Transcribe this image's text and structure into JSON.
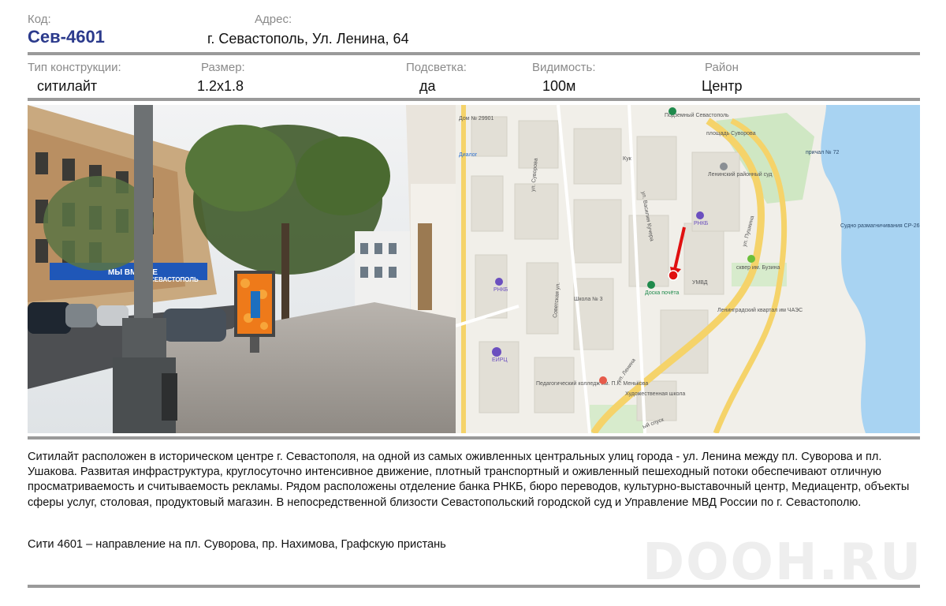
{
  "header": {
    "code_label": "Код:",
    "code_value": "Сев-4601",
    "address_label": "Адрес:",
    "address_value": "г. Севастополь, Ул. Ленина, 64"
  },
  "specs": {
    "type_label": "Тип конструкции:",
    "type_value": "ситилайт",
    "size_label": "Размер:",
    "size_value": "1.2x1.8",
    "light_label": "Подсветка:",
    "light_value": "да",
    "visibility_label": "Видимость:",
    "visibility_value": "100м",
    "district_label": "Район",
    "district_value": "Центр"
  },
  "photo": {
    "sign_text": "МЫ ВМЕСТЕ",
    "sign_text2": "СЕВАСТОПОЛЬ"
  },
  "map": {
    "labels": {
      "metro": "Подземный Севастополь",
      "square": "площадь Суворова",
      "pier": "причал № 72",
      "court": "Ленинский районный суд",
      "rnkb1": "РНКБ",
      "pushkina": "ул. Пушкина",
      "ship": "Судно размагничивания СР-26",
      "square2": "сквер им. Бузина",
      "umvd": "УМВД",
      "board": "Доска почёта",
      "leningrad": "Ленинградский квартал им ЧАЭС",
      "suvorova": "ул. Суворова",
      "kucera": "ул. Василия Кучера",
      "sovetskaya": "Советская ул.",
      "school3": "Школа № 3",
      "rnkb2": "РНКБ",
      "eirc": "ЕИРЦ",
      "lenina": "ул. Ленина",
      "college": "Педагогический колледж им. П.К. Менькова",
      "artschool": "Художественная школа",
      "descent": "ый спуск",
      "dialog": "Диалог",
      "kuk": "Кук",
      "house": "Дом № 29901"
    }
  },
  "description": "Ситилайт  расположен в историческом центре г. Севастополя, на одной из самых оживленных центральных улиц  города - ул. Ленина между пл. Суворова и пл. Ушакова. Развитая инфраструктура, круглосуточно интенсивное движение, плотный транспортный и оживленный пешеходный потоки обеспечивают отличную просматриваемость и считываемость рекламы. Рядом расположены отделение банка РНКБ, бюро переводов,  культурно-выставочный центр, Медиацентр, объекты сферы услуг, столовая, продуктовый магазин. В непосредственной близости Севастопольский городской суд и Управление МВД России по г. Севастополю.",
  "note": "Сити 4601 – направление на пл. Суворова, пр. Нахимова, Графскую пристань",
  "watermark": "DOOH.RU"
}
